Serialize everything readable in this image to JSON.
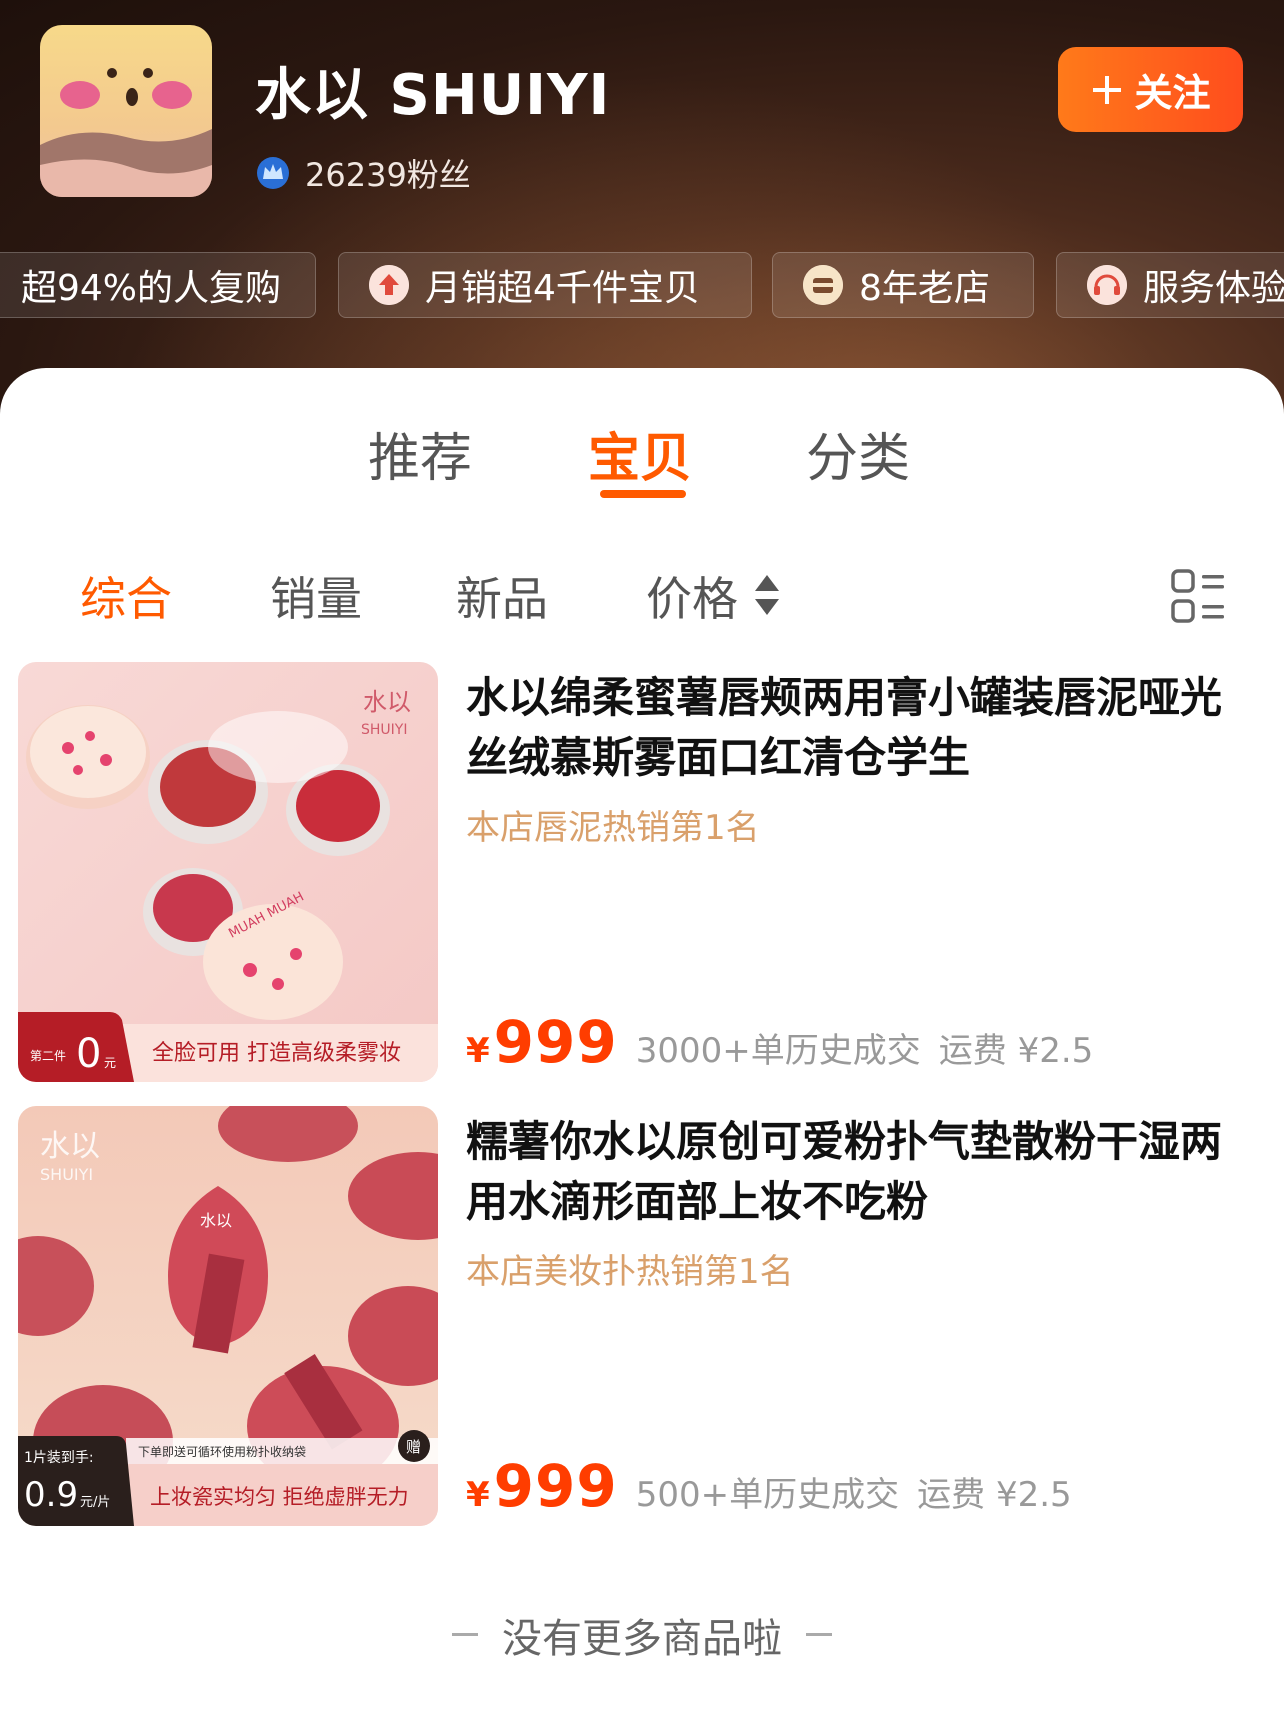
{
  "shop": {
    "name": "水以 SHUIYI",
    "fans": "26239粉丝",
    "follow_label": "关注"
  },
  "chips": [
    {
      "label": "超94%的人复购",
      "icon": "repurchase-icon"
    },
    {
      "label": "月销超4千件宝贝",
      "icon": "up-arrow-icon"
    },
    {
      "label": "8年老店",
      "icon": "shop-age-icon"
    },
    {
      "label": "服务体验",
      "icon": "service-headset-icon"
    }
  ],
  "tabs": [
    {
      "label": "推荐"
    },
    {
      "label": "宝贝"
    },
    {
      "label": "分类"
    }
  ],
  "sort": {
    "items": [
      {
        "label": "综合"
      },
      {
        "label": "销量"
      },
      {
        "label": "新品"
      },
      {
        "label": "价格"
      }
    ]
  },
  "products": [
    {
      "title": "水以绵柔蜜薯唇颊两用膏小罐装唇泥哑光丝绒慕斯雾面口红清仓学生",
      "rank": "本店唇泥热销第1名",
      "currency": "¥",
      "price": "999",
      "sold": "3000+单历史成交",
      "shipping": "运费 ¥2.5",
      "img": {
        "brand_cn": "水以",
        "brand_en": "SHUIYI",
        "promo_small": "第二件",
        "promo_big": "0",
        "promo_unit": "元",
        "banner": "全脸可用  打造高级柔雾妆",
        "lid_text": "MUAH MUAH"
      }
    },
    {
      "title": "糯薯你水以原创可爱粉扑气垫散粉干湿两用水滴形面部上妆不吃粉",
      "rank": "本店美妆扑热销第1名",
      "currency": "¥",
      "price": "999",
      "sold": "500+单历史成交",
      "shipping": "运费 ¥2.5",
      "img": {
        "brand_cn": "水以",
        "brand_en": "SHUIYI",
        "promo_small": "1片装到手:",
        "promo_big": "0.9",
        "promo_unit": "元/片",
        "gift_note": "下单即送可循环使用粉扑收纳袋",
        "gift_badge": "赠",
        "banner": "上妆瓷实均匀  拒绝虚胖无力"
      }
    }
  ],
  "footer": "没有更多商品啦"
}
